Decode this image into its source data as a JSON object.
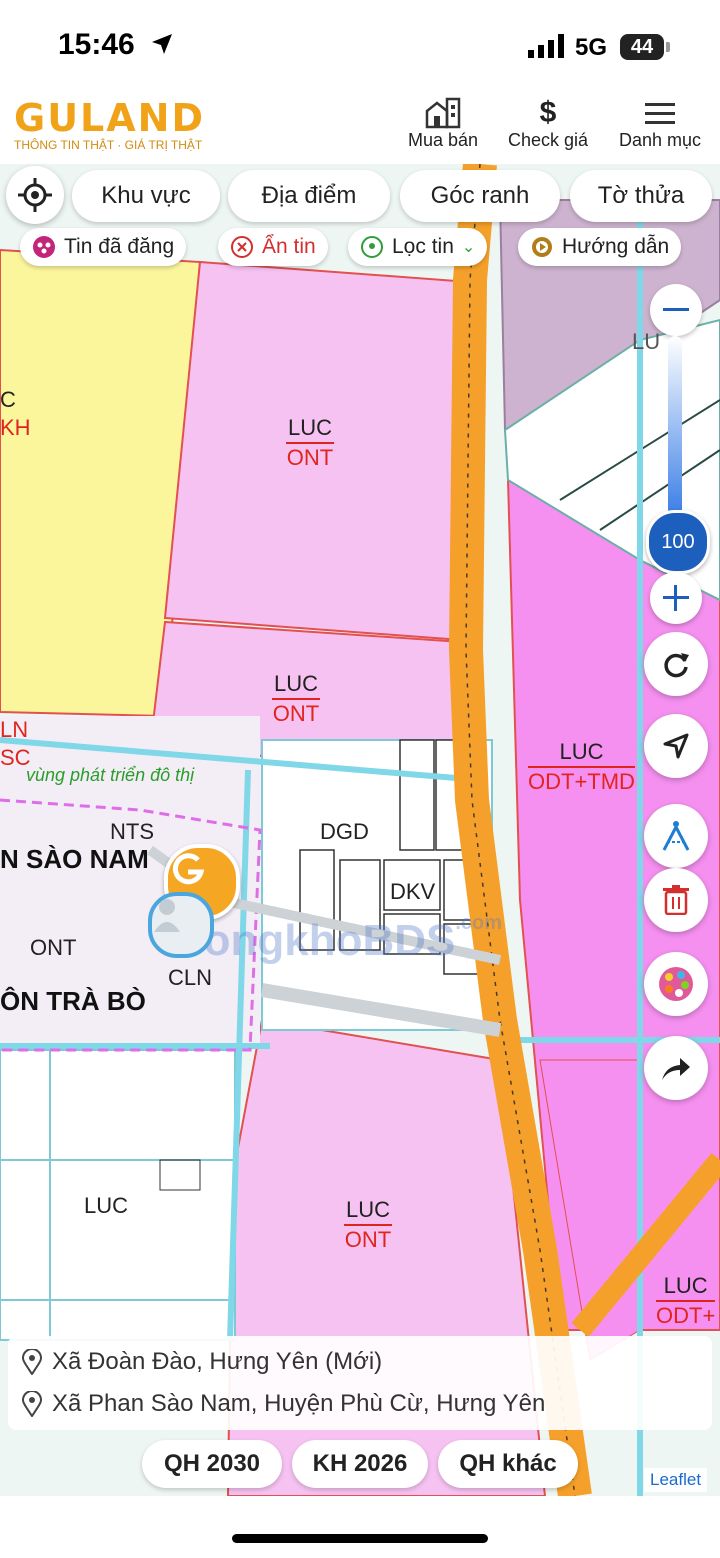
{
  "status_bar": {
    "time": "15:46",
    "network": "5G",
    "battery": "44"
  },
  "brand": {
    "name": "GULAND",
    "tagline": "THÔNG TIN THẬT · GIÁ TRỊ THẬT"
  },
  "nav": {
    "buy_sell": "Mua bán",
    "check_price": "Check giá",
    "menu": "Danh mục"
  },
  "search_chips": [
    "Khu vực",
    "Địa điểm",
    "Góc ranh",
    "Tờ thửa"
  ],
  "filters": {
    "posted": "Tin đã đăng",
    "hide": "Ẩn tin",
    "filter": "Lọc tin",
    "guide": "Hướng dẫn"
  },
  "zoom": {
    "level": "100"
  },
  "map_labels": {
    "luc": "LUC",
    "ont": "ONT",
    "odt_tmd": "ODT+TMD",
    "odt_plus": "ODT+",
    "dgd": "DGD",
    "dkv": "DKV",
    "nts": "NTS",
    "cln": "CLN",
    "place_1": "N SÀO NAM",
    "place_2": "ÔN TRÀ BÒ",
    "dev_zone": "vùng phát triển đô thị",
    "tmd": "TMD",
    "lu": "LU",
    "c": "C",
    "kh": "KH",
    "ln": "LN",
    "sc": "SC"
  },
  "watermark": {
    "text": "TongkhoBDS",
    "suffix": ".com"
  },
  "address": {
    "new": "Xã Đoàn Đào, Hưng Yên (Mới)",
    "old": "Xã Phan Sào Nam, Huyện Phù Cừ, Hưng Yên"
  },
  "plans": [
    "QH 2030",
    "KH 2026",
    "QH khác"
  ],
  "attribution": "Leaflet",
  "colors": {
    "brand": "#f0a318",
    "road": "#f5a02a",
    "pink": "#f6c2f2",
    "magenta": "#f590f0",
    "yellow": "#fbf59c",
    "accent_blue": "#1d5fbd"
  }
}
